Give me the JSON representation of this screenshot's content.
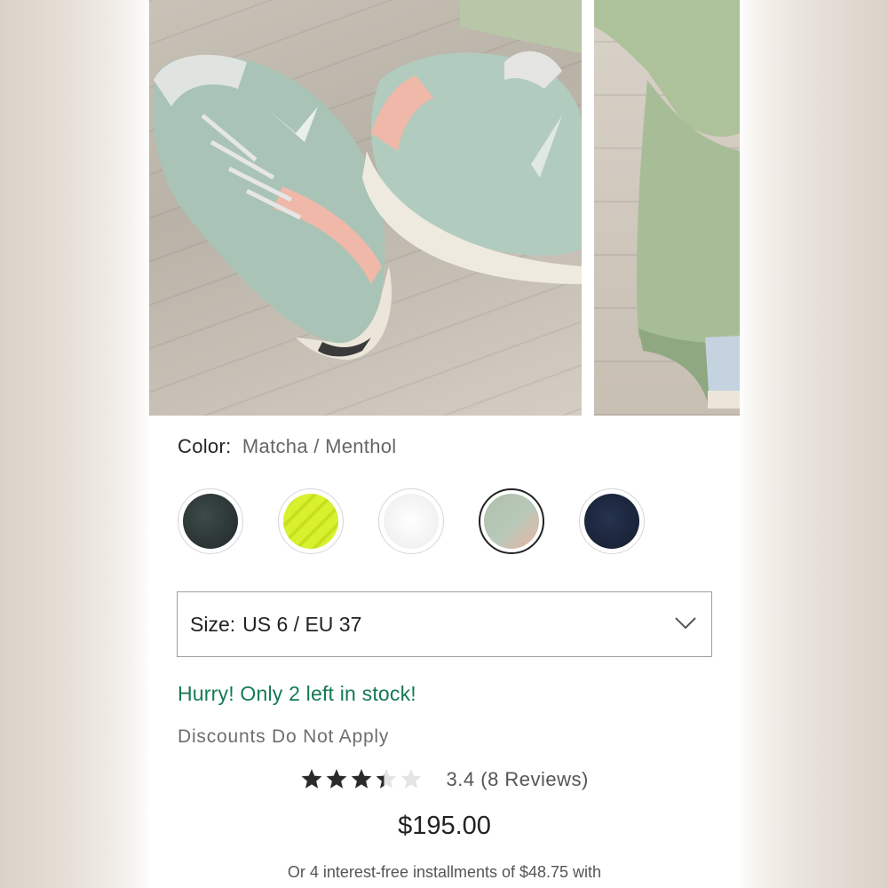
{
  "product": {
    "color_label": "Color:",
    "color_value": "Matcha / Menthol",
    "swatches": [
      {
        "name": "dark-green",
        "color": "#2b3533"
      },
      {
        "name": "neon-yellow",
        "color": "#d9f02f"
      },
      {
        "name": "white",
        "color": "#f4f4f4"
      },
      {
        "name": "matcha-menthol",
        "color": "#aebfac",
        "selected": true
      },
      {
        "name": "navy",
        "color": "#1b2740"
      }
    ],
    "size_label": "Size:",
    "size_value": "US 6 / EU 37",
    "stock_message": "Hurry! Only 2 left in stock!",
    "discount_note": "Discounts Do Not Apply",
    "rating": 3.4,
    "rating_text": "3.4 (8 Reviews)",
    "price": "$195.00",
    "installments_text": "Or 4 interest-free installments of $48.75 with"
  },
  "icons": {
    "size_dropdown": "chevron-down-icon",
    "rating": "star-icon"
  },
  "colors": {
    "stock_green": "#137a52",
    "selected_border": "#222222"
  }
}
